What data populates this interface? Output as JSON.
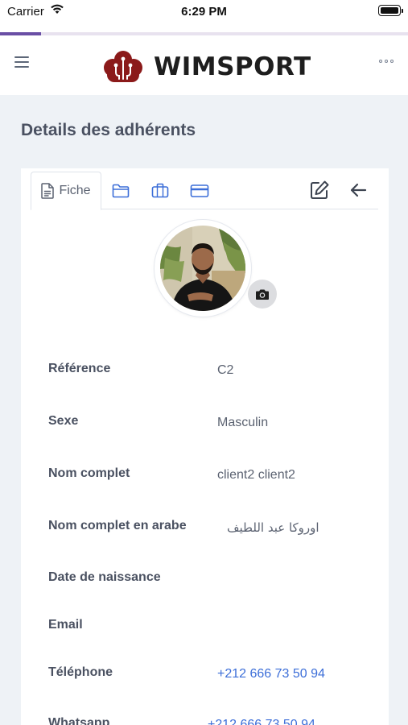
{
  "status_bar": {
    "carrier": "Carrier",
    "time": "6:29 PM"
  },
  "load_progress": {
    "fraction": 0.1
  },
  "header": {
    "brand": "WIMSPORT",
    "brand_color": "#8b1a1a"
  },
  "page": {
    "title": "Details des adhérents"
  },
  "tabs": [
    {
      "label": "Fiche",
      "icon": "document-icon",
      "active": true
    },
    {
      "label": "",
      "icon": "folder-icon"
    },
    {
      "label": "",
      "icon": "briefcase-icon"
    },
    {
      "label": "",
      "icon": "credit-card-icon"
    }
  ],
  "toolbar": {
    "edit_icon": "edit-icon",
    "back_icon": "arrow-left-icon"
  },
  "accent_color": "#3c6ed8",
  "fields": [
    {
      "label": "Référence",
      "value": "C2"
    },
    {
      "label": "Sexe",
      "value": "Masculin"
    },
    {
      "label": "Nom complet",
      "value": "client2 client2"
    },
    {
      "label": "Nom complet en arabe",
      "value": "اوروكا عبد اللطيف"
    },
    {
      "label": "Date de naissance",
      "value": ""
    },
    {
      "label": "Email",
      "value": ""
    },
    {
      "label": "Téléphone",
      "value": "+212 666 73 50 94"
    },
    {
      "label": "Whatsapp",
      "value": "+212 666 73 50 94"
    }
  ]
}
